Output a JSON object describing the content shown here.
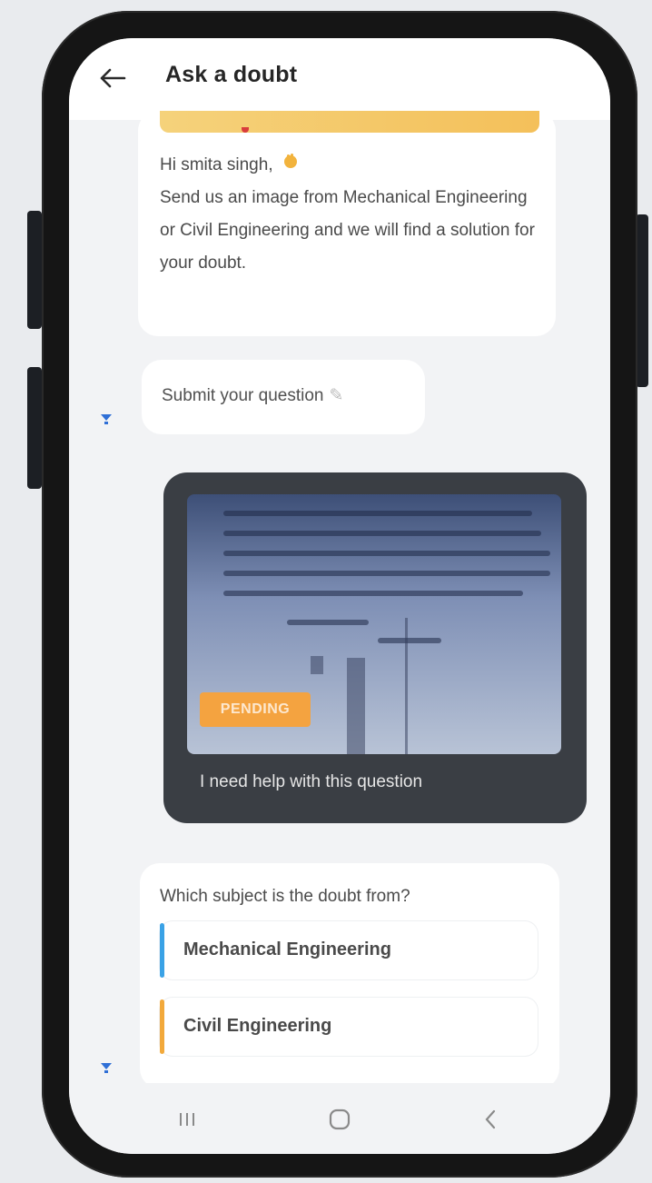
{
  "header": {
    "title": "Ask a doubt",
    "back_icon": "arrow-left-icon"
  },
  "chat": {
    "welcome": {
      "greeting": "Hi smita singh,",
      "greeting_icon": "waving-hand-icon",
      "message": "Send us an image from Mechanical Engineering or Civil Engineering and we will find a solution for your doubt."
    },
    "submit_prompt": {
      "text": "Submit your question",
      "icon": "edit-pen-icon"
    },
    "image_message": {
      "status": "PENDING",
      "caption": "I need help with this question"
    },
    "subject_prompt": {
      "question": "Which subject is the doubt from?",
      "options": [
        {
          "label": "Mechanical Engineering",
          "accent": "#3aa2e6"
        },
        {
          "label": "Civil Engineering",
          "accent": "#f2a93b"
        }
      ]
    }
  },
  "navbar": {
    "recent_icon": "recent-apps-icon",
    "home_icon": "home-icon",
    "back_icon": "nav-back-icon"
  },
  "colors": {
    "bot_marker": "#2f6fd6",
    "pending_badge": "#f4a340",
    "image_card": "#3a3e44",
    "banner": "#f4c05a"
  }
}
